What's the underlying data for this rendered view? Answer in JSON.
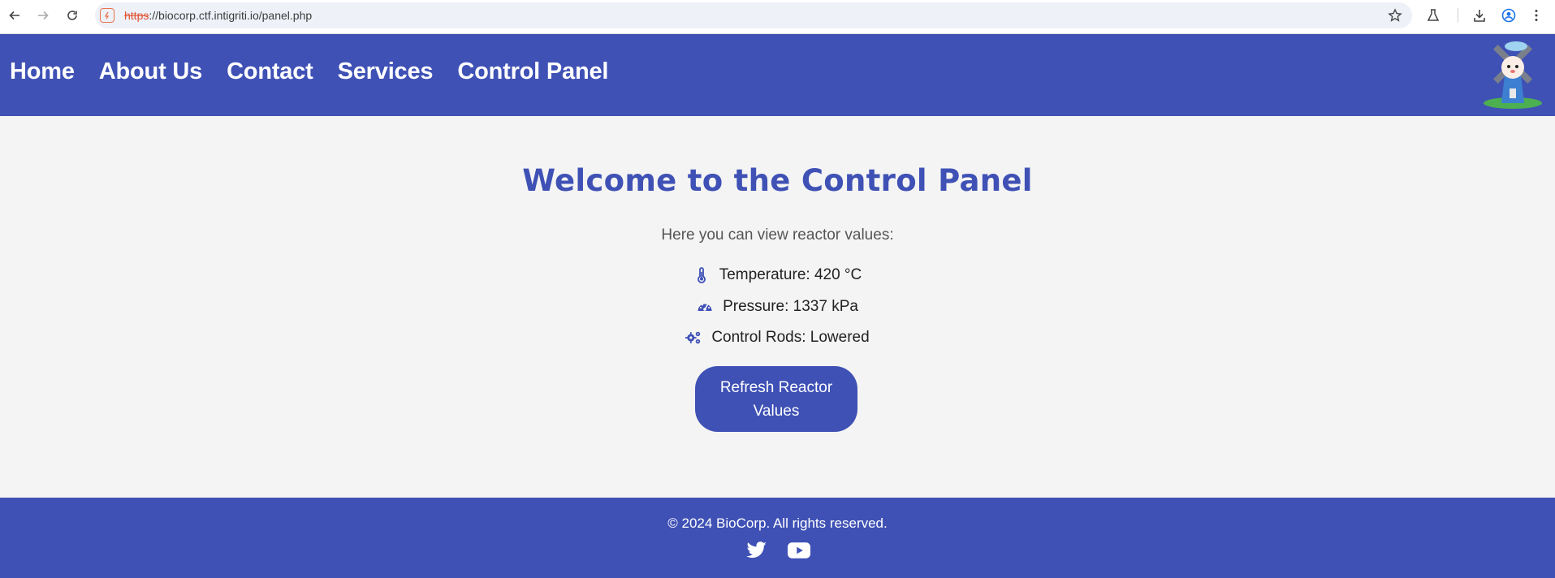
{
  "browser": {
    "url_scheme": "https",
    "url_rest": "://biocorp.ctf.intigriti.io/panel.php"
  },
  "nav": {
    "items": [
      "Home",
      "About Us",
      "Contact",
      "Services",
      "Control Panel"
    ]
  },
  "main": {
    "title": "Welcome to the Control Panel",
    "subtitle": "Here you can view reactor values:",
    "readings": [
      {
        "icon": "thermometer-icon",
        "text": "Temperature: 420 °C"
      },
      {
        "icon": "gauge-icon",
        "text": "Pressure: 1337 kPa"
      },
      {
        "icon": "gears-icon",
        "text": "Control Rods: Lowered"
      }
    ],
    "refresh_label": "Refresh Reactor Values"
  },
  "footer": {
    "copyright": "© 2024 BioCorp. All rights reserved.",
    "social": [
      "twitter-icon",
      "youtube-icon"
    ]
  },
  "colors": {
    "brand": "#3f51b5",
    "background": "#f4f4f4"
  }
}
